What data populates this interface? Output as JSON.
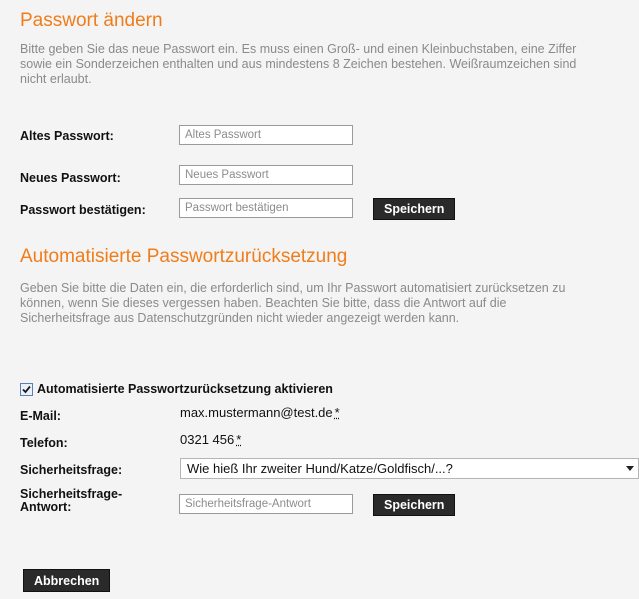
{
  "change_password": {
    "title": "Passwort ändern",
    "intro": "Bitte geben Sie das neue Passwort ein. Es muss einen Groß- und einen Kleinbuchstaben, eine Ziffer sowie ein Sonderzeichen enthalten und aus mindestens 8 Zeichen bestehen. Weißraumzeichen sind nicht erlaubt.",
    "old_label": "Altes Passwort:",
    "old_placeholder": "Altes Passwort",
    "new_label": "Neues Passwort:",
    "new_placeholder": "Neues Passwort",
    "confirm_label": "Passwort bestätigen:",
    "confirm_placeholder": "Passwort bestätigen",
    "save_label": "Speichern"
  },
  "reset": {
    "title": "Automatisierte Passwortzurücksetzung",
    "intro": "Geben Sie bitte die Daten ein, die erforderlich sind, um Ihr Passwort automatisiert zurücksetzen zu können, wenn Sie dieses vergessen haben. Beachten Sie bitte, dass die Antwort auf die Sicherheitsfrage aus Datenschutzgründen nicht wieder angezeigt werden kann.",
    "enable_label": "Automatisierte Passwortzurücksetzung aktivieren",
    "enabled": true,
    "email_label": "E-Mail:",
    "email_value": "max.mustermann@test.de",
    "phone_label": "Telefon:",
    "phone_value": "0321 456",
    "required_marker": "*",
    "question_label": "Sicherheitsfrage:",
    "question_value": "Wie hieß Ihr zweiter Hund/Katze/Goldfisch/...?",
    "answer_label": "Sicherheitsfrage-Antwort:",
    "answer_placeholder": "Sicherheitsfrage-Antwort",
    "save_label": "Speichern"
  },
  "cancel_label": "Abbrechen",
  "colors": {
    "accent": "#f07d1a",
    "button": "#2a2a2a",
    "muted_text": "#8a8a8a"
  }
}
